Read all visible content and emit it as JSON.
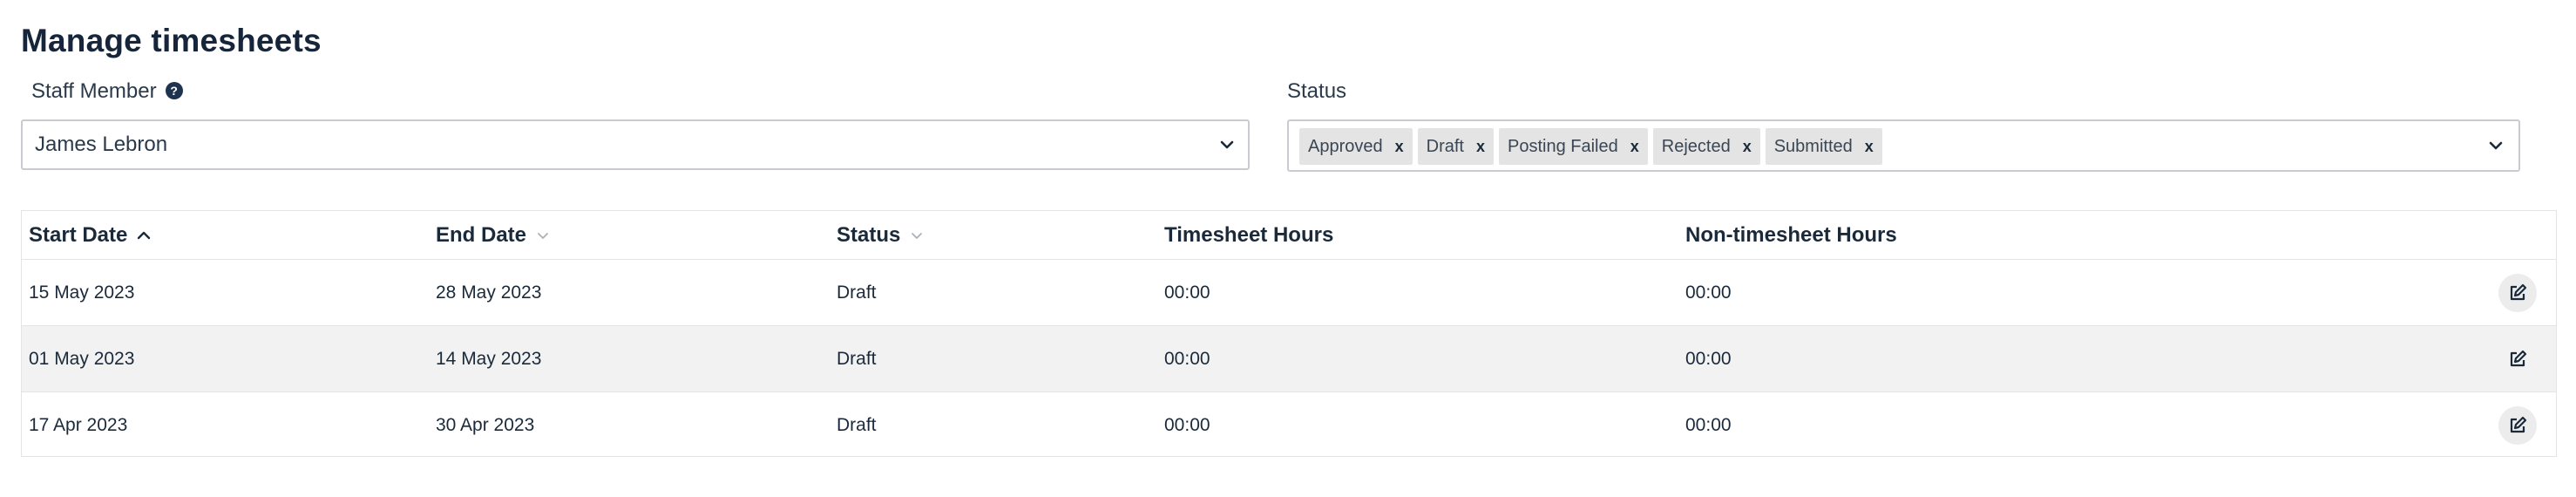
{
  "page": {
    "title": "Manage timesheets"
  },
  "filters": {
    "staff": {
      "label": "Staff Member",
      "value": "James Lebron",
      "help_icon": "question-circle-icon"
    },
    "status": {
      "label": "Status",
      "tags": [
        "Approved",
        "Draft",
        "Posting Failed",
        "Rejected",
        "Submitted"
      ],
      "remove_glyph": "x"
    }
  },
  "table": {
    "columns": [
      "Start Date",
      "End Date",
      "Status",
      "Timesheet Hours",
      "Non-timesheet Hours"
    ],
    "rows": [
      {
        "start": "15 May 2023",
        "end": "28 May 2023",
        "status": "Draft",
        "ts_hours": "00:00",
        "nts_hours": "00:00"
      },
      {
        "start": "01 May 2023",
        "end": "14 May 2023",
        "status": "Draft",
        "ts_hours": "00:00",
        "nts_hours": "00:00"
      },
      {
        "start": "17 Apr 2023",
        "end": "30 Apr 2023",
        "status": "Draft",
        "ts_hours": "00:00",
        "nts_hours": "00:00"
      }
    ],
    "sort": {
      "column": "Start Date",
      "direction": "ascending"
    }
  },
  "colors": {
    "text": "#1b2a3a",
    "border": "#c8ccd1",
    "tag_bg": "#e4e4e4",
    "alt_row": "#f2f2f2"
  }
}
